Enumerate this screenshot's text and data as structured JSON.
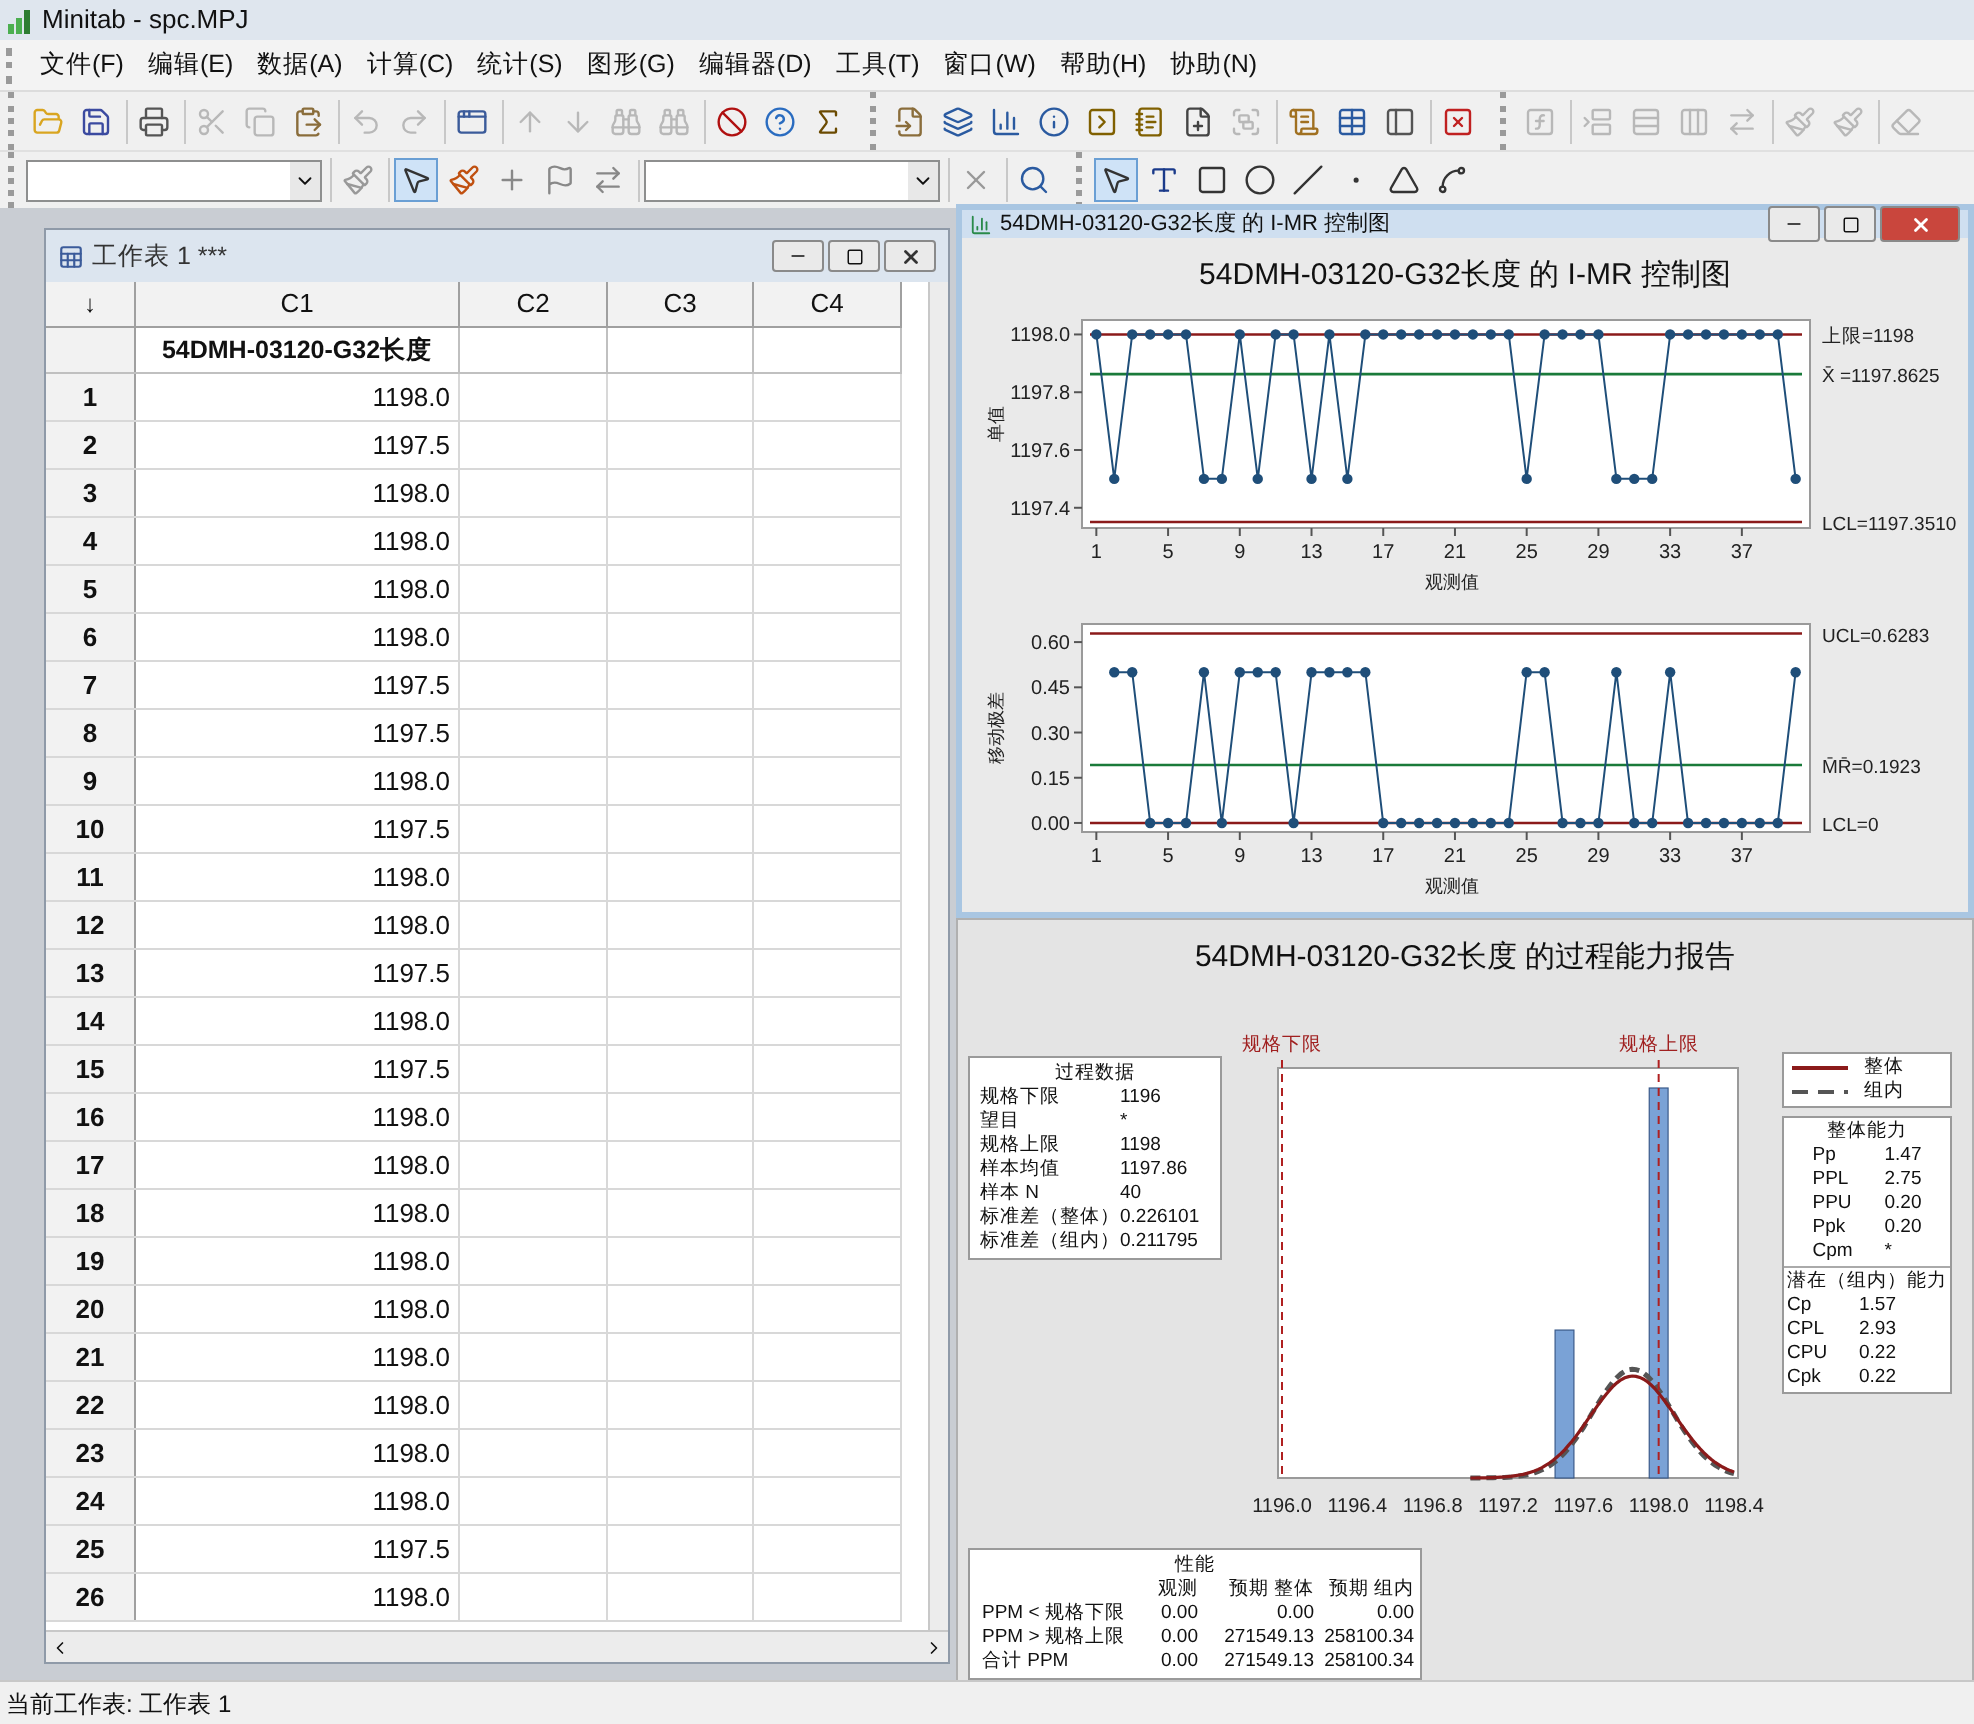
{
  "window": {
    "title": "Minitab - spc.MPJ"
  },
  "menu": [
    "文件(F)",
    "编辑(E)",
    "数据(A)",
    "计算(C)",
    "统计(S)",
    "图形(G)",
    "编辑器(D)",
    "工具(T)",
    "窗口(W)",
    "帮助(H)",
    "协助(N)"
  ],
  "toolbar_top": [
    [
      [
        {
          "kind": "open",
          "disabled": false
        },
        {
          "kind": "save",
          "disabled": false
        }
      ],
      [
        {
          "kind": "print",
          "disabled": false
        }
      ],
      [
        {
          "kind": "cut",
          "disabled": true
        },
        {
          "kind": "copy",
          "disabled": true
        },
        {
          "kind": "paste",
          "disabled": false
        }
      ],
      [
        {
          "kind": "undo",
          "disabled": true
        },
        {
          "kind": "redo",
          "disabled": true
        }
      ],
      [
        {
          "kind": "session",
          "disabled": false
        }
      ],
      [
        {
          "kind": "up",
          "disabled": true
        },
        {
          "kind": "down",
          "disabled": true
        },
        {
          "kind": "find",
          "disabled": true
        },
        {
          "kind": "replace",
          "disabled": true
        }
      ],
      [
        {
          "kind": "cancel",
          "disabled": false
        },
        {
          "kind": "help",
          "disabled": false
        },
        {
          "kind": "sigma",
          "disabled": false
        }
      ]
    ],
    [
      [
        {
          "kind": "append",
          "disabled": false
        },
        {
          "kind": "worksheets",
          "disabled": false
        },
        {
          "kind": "graphs",
          "disabled": false
        },
        {
          "kind": "info",
          "disabled": false
        },
        {
          "kind": "history",
          "disabled": false
        },
        {
          "kind": "notes",
          "disabled": false
        },
        {
          "kind": "newdoc",
          "disabled": false
        },
        {
          "kind": "layout",
          "disabled": true
        }
      ],
      [
        {
          "kind": "report",
          "disabled": false
        },
        {
          "kind": "table",
          "disabled": false
        },
        {
          "kind": "sidebar",
          "disabled": false
        }
      ],
      [
        {
          "kind": "closegraphs",
          "disabled": false
        }
      ]
    ],
    [
      [
        {
          "kind": "fx",
          "disabled": true
        }
      ],
      [
        {
          "kind": "insertcells",
          "disabled": true
        },
        {
          "kind": "insertrows",
          "disabled": true
        },
        {
          "kind": "insertcols",
          "disabled": true
        },
        {
          "kind": "movecols",
          "disabled": true
        }
      ],
      [
        {
          "kind": "brushup",
          "disabled": true
        },
        {
          "kind": "brushdown",
          "disabled": true
        }
      ],
      [
        {
          "kind": "eraser",
          "disabled": true
        }
      ]
    ]
  ],
  "toolbar_bottom": [
    [
      [
        {
          "kind": "dropdown"
        }
      ],
      [
        {
          "kind": "brushtool",
          "selected": false
        }
      ],
      [
        {
          "kind": "pointer",
          "selected": true
        },
        {
          "kind": "paintbrush",
          "selected": false
        },
        {
          "kind": "crosshair",
          "selected": false
        },
        {
          "kind": "flag",
          "selected": false
        },
        {
          "kind": "swap",
          "selected": false
        }
      ],
      [
        {
          "kind": "dropdown"
        }
      ],
      [
        {
          "kind": "close",
          "selected": false
        }
      ],
      [
        {
          "kind": "zoom",
          "selected": false
        }
      ]
    ],
    [
      [
        {
          "kind": "pointer",
          "selected": true
        },
        {
          "kind": "text",
          "selected": false
        },
        {
          "kind": "rect",
          "selected": false
        },
        {
          "kind": "ellipse",
          "selected": false
        },
        {
          "kind": "line",
          "selected": false
        },
        {
          "kind": "dot",
          "selected": false
        },
        {
          "kind": "polygon",
          "selected": false
        },
        {
          "kind": "polyline",
          "selected": false
        }
      ]
    ]
  ],
  "worksheet": {
    "title": "工作表 1 ***",
    "corner": "↓",
    "columns": [
      "C1",
      "C2",
      "C3",
      "C4"
    ],
    "column_names": [
      "54DMH-03120-G32长度"
    ],
    "rows": [
      {
        "label": "1",
        "cells": [
          "1198.0"
        ]
      },
      {
        "label": "2",
        "cells": [
          "1197.5"
        ]
      },
      {
        "label": "3",
        "cells": [
          "1198.0"
        ]
      },
      {
        "label": "4",
        "cells": [
          "1198.0"
        ]
      },
      {
        "label": "5",
        "cells": [
          "1198.0"
        ]
      },
      {
        "label": "6",
        "cells": [
          "1198.0"
        ]
      },
      {
        "label": "7",
        "cells": [
          "1197.5"
        ]
      },
      {
        "label": "8",
        "cells": [
          "1197.5"
        ]
      },
      {
        "label": "9",
        "cells": [
          "1198.0"
        ]
      },
      {
        "label": "10",
        "cells": [
          "1197.5"
        ]
      },
      {
        "label": "11",
        "cells": [
          "1198.0"
        ]
      },
      {
        "label": "12",
        "cells": [
          "1198.0"
        ]
      },
      {
        "label": "13",
        "cells": [
          "1197.5"
        ]
      },
      {
        "label": "14",
        "cells": [
          "1198.0"
        ]
      },
      {
        "label": "15",
        "cells": [
          "1197.5"
        ]
      },
      {
        "label": "16",
        "cells": [
          "1198.0"
        ]
      },
      {
        "label": "17",
        "cells": [
          "1198.0"
        ]
      },
      {
        "label": "18",
        "cells": [
          "1198.0"
        ]
      },
      {
        "label": "19",
        "cells": [
          "1198.0"
        ]
      },
      {
        "label": "20",
        "cells": [
          "1198.0"
        ]
      },
      {
        "label": "21",
        "cells": [
          "1198.0"
        ]
      },
      {
        "label": "22",
        "cells": [
          "1198.0"
        ]
      },
      {
        "label": "23",
        "cells": [
          "1198.0"
        ]
      },
      {
        "label": "24",
        "cells": [
          "1198.0"
        ]
      },
      {
        "label": "25",
        "cells": [
          "1197.5"
        ]
      },
      {
        "label": "26",
        "cells": [
          "1198.0"
        ]
      }
    ]
  },
  "control_chart_window": {
    "title": "54DMH-03120-G32长度 的 I-MR 控制图",
    "heading": "54DMH-03120-G32长度 的 I-MR 控制图",
    "charts": [
      {
        "chart_data": {
          "type": "line",
          "xlabel": "观测值",
          "ylabel": "单值",
          "x": [
            1,
            2,
            3,
            4,
            5,
            6,
            7,
            8,
            9,
            10,
            11,
            12,
            13,
            14,
            15,
            16,
            17,
            18,
            19,
            20,
            21,
            22,
            23,
            24,
            25,
            26,
            27,
            28,
            29,
            30,
            31,
            32,
            33,
            34,
            35,
            36,
            37,
            38,
            39,
            40
          ],
          "ylim": [
            1197.33,
            1198.05
          ],
          "series": [
            {
              "color": "#1f4e79",
              "marker": "o",
              "values": [
                1198,
                1197.5,
                1198,
                1198,
                1198,
                1198,
                1197.5,
                1197.5,
                1198,
                1197.5,
                1198,
                1198,
                1197.5,
                1198,
                1197.5,
                1198,
                1198,
                1198,
                1198,
                1198,
                1198,
                1198,
                1198,
                1198,
                1197.5,
                1198,
                1198,
                1198,
                1198,
                1197.5,
                1197.5,
                1197.5,
                1198,
                1198,
                1198,
                1198,
                1198,
                1198,
                1198,
                1197.5
              ]
            }
          ],
          "xticks": [
            1,
            5,
            9,
            13,
            17,
            21,
            25,
            29,
            33,
            37
          ],
          "xlim": [
            0.2,
            40.8
          ],
          "yticks": [
            {
              "value": 1197.4,
              "label": "1197.4"
            },
            {
              "value": 1197.6,
              "label": "1197.6"
            },
            {
              "value": 1197.8,
              "label": "1197.8"
            },
            {
              "value": 1198,
              "label": "1198.0"
            }
          ],
          "ref_lines": [
            {
              "axis": "y",
              "value": 1198,
              "label": "上限=1198",
              "color": "#8b1a1a"
            },
            {
              "axis": "y",
              "value": 1197.8625,
              "label": "X̄ =1197.8625",
              "color": "#1a7a3a"
            },
            {
              "axis": "y",
              "value": 1197.351,
              "label": "LCL=1197.3510",
              "color": "#8b1a1a"
            }
          ]
        }
      },
      {
        "chart_data": {
          "type": "line",
          "xlabel": "观测值",
          "ylabel": "移动极差",
          "x": [
            2,
            3,
            4,
            5,
            6,
            7,
            8,
            9,
            10,
            11,
            12,
            13,
            14,
            15,
            16,
            17,
            18,
            19,
            20,
            21,
            22,
            23,
            24,
            25,
            26,
            27,
            28,
            29,
            30,
            31,
            32,
            33,
            34,
            35,
            36,
            37,
            38,
            39,
            40
          ],
          "ylim": [
            -0.03,
            0.66
          ],
          "series": [
            {
              "color": "#1f4e79",
              "marker": "o",
              "values": [
                0.5,
                0.5,
                0,
                0,
                0,
                0.5,
                0,
                0.5,
                0.5,
                0.5,
                0,
                0.5,
                0.5,
                0.5,
                0.5,
                0,
                0,
                0,
                0,
                0,
                0,
                0,
                0,
                0.5,
                0.5,
                0,
                0,
                0,
                0.5,
                0,
                0,
                0.5,
                0,
                0,
                0,
                0,
                0,
                0,
                0.5
              ]
            }
          ],
          "xticks": [
            1,
            5,
            9,
            13,
            17,
            21,
            25,
            29,
            33,
            37
          ],
          "xlim": [
            0.2,
            40.8
          ],
          "yticks": [
            {
              "value": 0,
              "label": "0.00"
            },
            {
              "value": 0.15,
              "label": "0.15"
            },
            {
              "value": 0.3,
              "label": "0.30"
            },
            {
              "value": 0.45,
              "label": "0.45"
            },
            {
              "value": 0.6,
              "label": "0.60"
            }
          ],
          "ref_lines": [
            {
              "axis": "y",
              "value": 0.6283,
              "label": "UCL=0.6283",
              "color": "#8b1a1a"
            },
            {
              "axis": "y",
              "value": 0.1923,
              "label": "M̄R̄=0.1923",
              "color": "#1a7a3a"
            },
            {
              "axis": "y",
              "value": 0,
              "label": "LCL=0",
              "color": "#8b1a1a"
            }
          ]
        }
      }
    ]
  },
  "capability_report": {
    "heading": "54DMH-03120-G32长度 的过程能力报告",
    "process_data": {
      "title": "过程数据",
      "rows": [
        {
          "label": "规格下限",
          "value": "1196"
        },
        {
          "label": "望目",
          "value": "*"
        },
        {
          "label": "规格上限",
          "value": "1198"
        },
        {
          "label": "样本均值",
          "value": "1197.86"
        },
        {
          "label": "样本 N",
          "value": "40"
        },
        {
          "label": "标准差（整体）",
          "value": "0.226101"
        },
        {
          "label": "标准差（组内）",
          "value": "0.211795"
        }
      ]
    },
    "histogram": {
      "lsl_label": "规格下限",
      "usl_label": "规格上限",
      "axis_labels": [
        "1196.0",
        "1196.4",
        "1196.8",
        "1197.2",
        "1197.6",
        "1198.0",
        "1198.4"
      ]
    },
    "legend": [
      {
        "kind": "solid",
        "label": "整体"
      },
      {
        "kind": "dashed",
        "label": "组内"
      }
    ],
    "overall_capability": {
      "title": "整体能力",
      "rows": [
        {
          "label": "Pp",
          "value": "1.47"
        },
        {
          "label": "PPL",
          "value": "2.75"
        },
        {
          "label": "PPU",
          "value": "0.20"
        },
        {
          "label": "Ppk",
          "value": "0.20"
        },
        {
          "label": "Cpm",
          "value": "*"
        }
      ]
    },
    "potential_capability": {
      "title": "潜在（组内）能力",
      "rows": [
        {
          "label": "Cp",
          "value": "1.57"
        },
        {
          "label": "CPL",
          "value": "2.93"
        },
        {
          "label": "CPU",
          "value": "0.22"
        },
        {
          "label": "Cpk",
          "value": "0.22"
        }
      ]
    },
    "performance": {
      "title": "性能",
      "columns": [
        "观测",
        "预期 整体",
        "预期 组内"
      ],
      "rows": [
        {
          "label": "PPM < 规格下限",
          "values": [
            "0.00",
            "0.00",
            "0.00"
          ]
        },
        {
          "label": "PPM > 规格上限",
          "values": [
            "0.00",
            "271549.13",
            "258100.34"
          ]
        },
        {
          "label": "合计 PPM",
          "values": [
            "0.00",
            "271549.13",
            "258100.34"
          ]
        }
      ]
    }
  },
  "status_bar": "当前工作表: 工作表 1"
}
